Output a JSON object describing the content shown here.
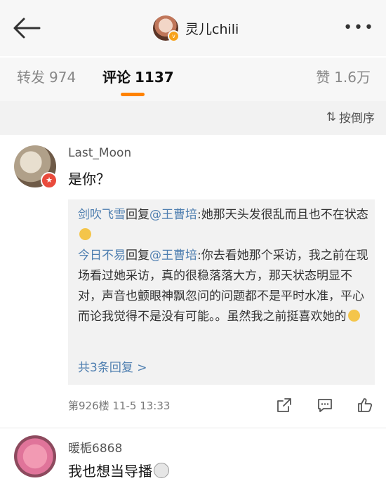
{
  "header": {
    "title": "灵儿chili",
    "back_icon": "back-arrow-icon",
    "more_label": "•••"
  },
  "tabs": {
    "repost": {
      "label": "转发",
      "count": "974"
    },
    "comment": {
      "label": "评论",
      "count": "1137"
    },
    "like": {
      "label": "赞",
      "count": "1.6万"
    }
  },
  "sort": {
    "icon": "⇅",
    "label": "按倒序"
  },
  "comment1": {
    "username": "Last_Moon",
    "text": "是你？",
    "replies": [
      {
        "author": "剑吹飞雪",
        "reply_word": "回复",
        "mention": "@王曹培",
        "text": ":她那天头发很乱而且也不在状态"
      },
      {
        "author": "今日不易",
        "reply_word": "回复",
        "mention": "@王曹培",
        "text": ":你去看她那个采访，我之前在现场看过她采访，真的很稳落落大方，那天状态明显不对，声音也颤眼神飘忽问的问题都不是平时水准，平心而论我觉得不是没有可能。。虽然我之前挺喜欢她的"
      }
    ],
    "view_more": "共3条回复 >",
    "meta": "第926楼  11-5 13:33"
  },
  "comment2": {
    "username": "暖栀6868",
    "text": "我也想当导播"
  },
  "colors": {
    "accent": "#ff8200",
    "link": "#4f7fb0",
    "badge": "#e94b3c"
  }
}
